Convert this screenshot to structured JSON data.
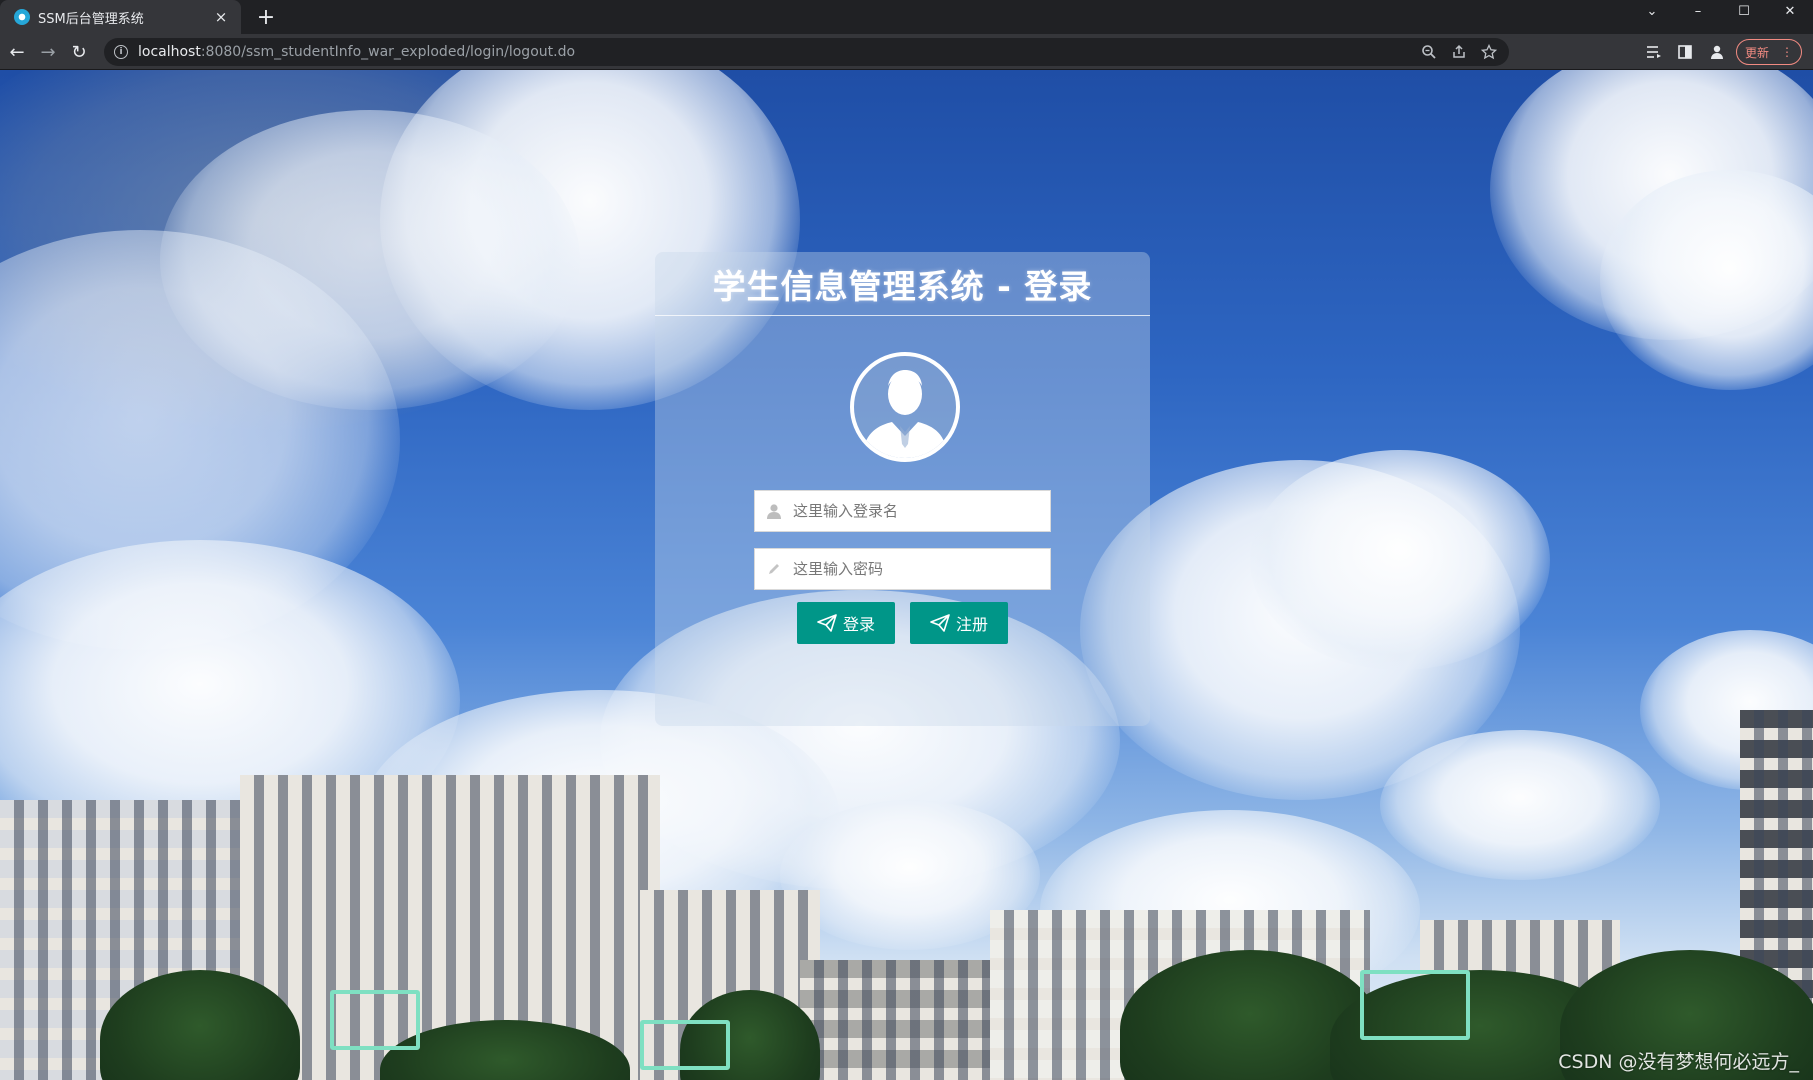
{
  "browser": {
    "tab_title": "SSM后台管理系统",
    "tab_close": "×",
    "new_tab": "+",
    "url_host": "localhost",
    "url_rest": ":8080/ssm_studentInfo_war_exploded/login/logout.do",
    "update_label": "更新",
    "update_menu": "⋮",
    "nav": {
      "back": "←",
      "forward": "→",
      "reload": "↻"
    },
    "window_controls": {
      "dropdown": "⌄",
      "minimize": "–",
      "maximize": "☐",
      "close": "✕"
    }
  },
  "login": {
    "title": "学生信息管理系统 - 登录",
    "username_placeholder": "这里输入登录名",
    "password_placeholder": "这里输入密码",
    "login_button": "登录",
    "register_button": "注册"
  },
  "colors": {
    "button": "#009688",
    "panel": "rgba(200,215,235,0.38)"
  },
  "icons": {
    "user": "user-icon",
    "password": "pencil-icon",
    "send": "paper-plane-icon",
    "avatar": "person-avatar-icon"
  },
  "watermark": "CSDN @没有梦想何必远方_"
}
